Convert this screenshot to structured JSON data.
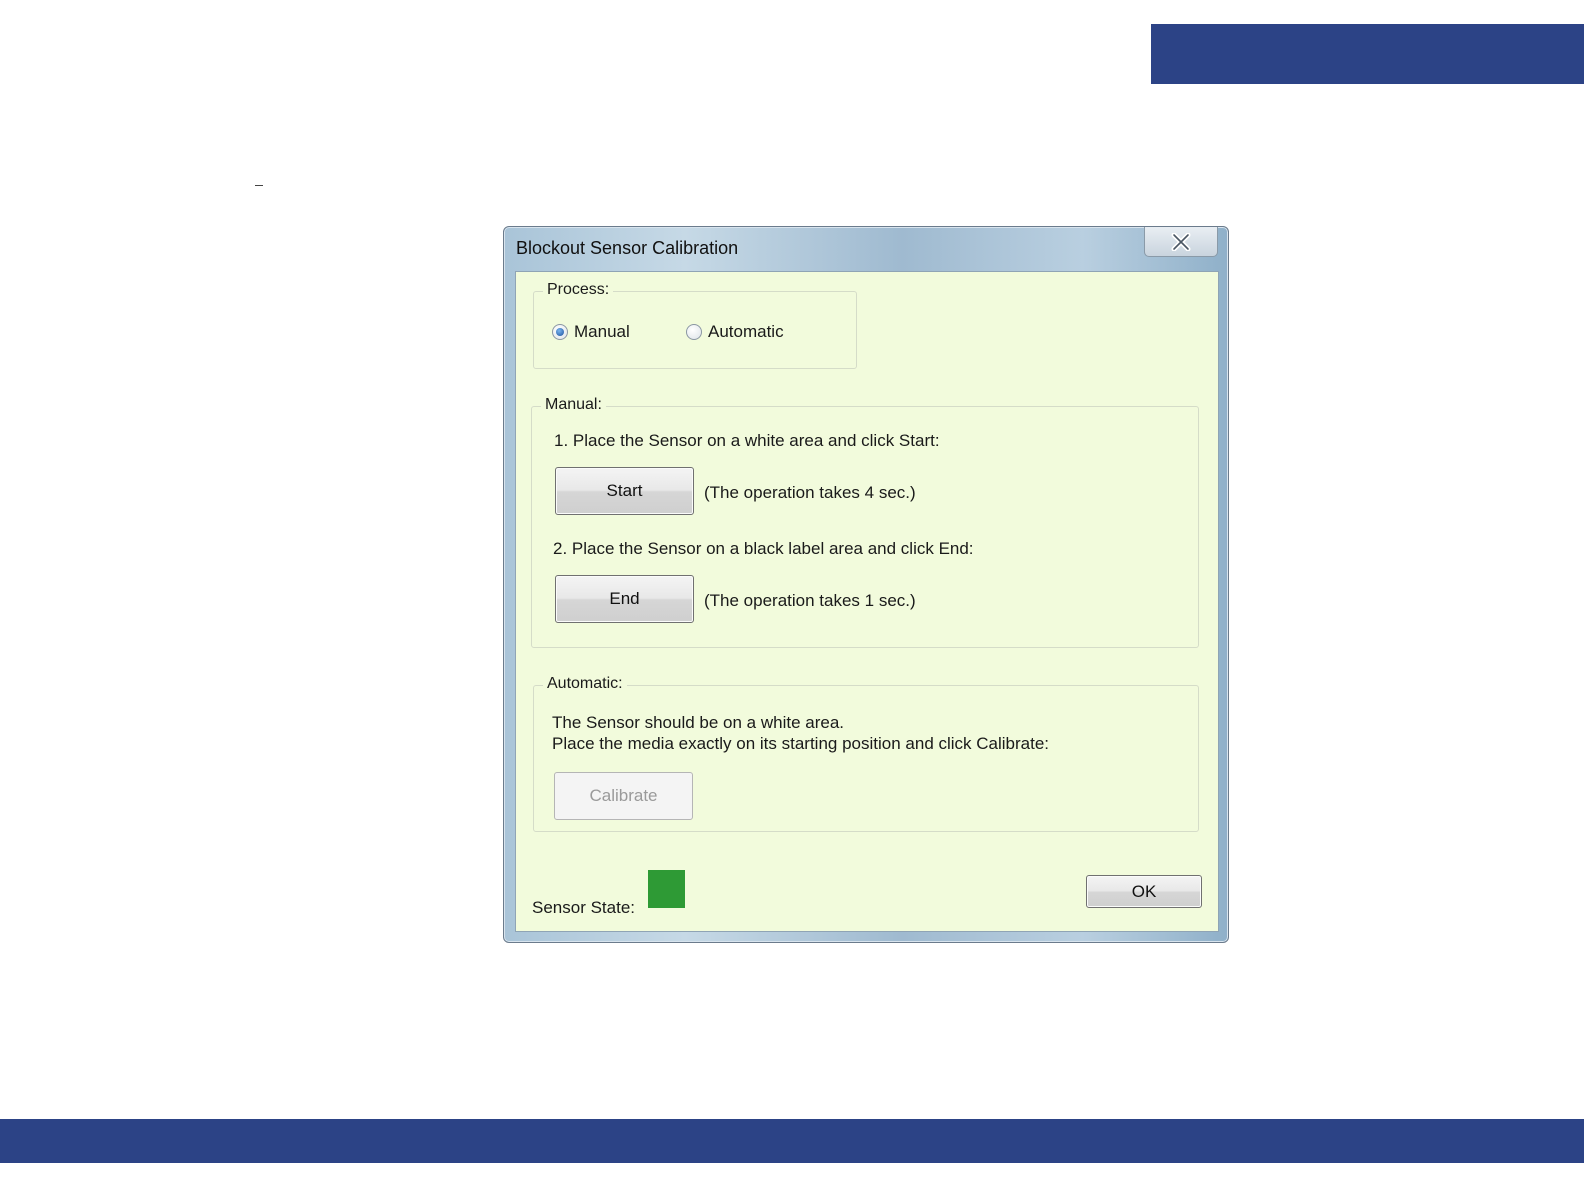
{
  "dialog": {
    "title": "Blockout Sensor Calibration",
    "close_icon": "close-icon"
  },
  "process": {
    "legend": "Process:",
    "options": [
      {
        "label": "Manual",
        "selected": true
      },
      {
        "label": "Automatic",
        "selected": false
      }
    ]
  },
  "manual": {
    "legend": "Manual:",
    "step1": "1. Place the Sensor on a white area and click Start:",
    "start_label": "Start",
    "start_note": "(The operation takes 4 sec.)",
    "step2": "2. Place the Sensor on a black label area and click End:",
    "end_label": "End",
    "end_note": "(The operation takes 1 sec.)"
  },
  "automatic": {
    "legend": "Automatic:",
    "line1": "The Sensor should be on a white area.",
    "line2": "Place the media exactly on its starting position and click Calibrate:",
    "calibrate_label": "Calibrate",
    "calibrate_enabled": false
  },
  "footer": {
    "sensor_label": "Sensor State:",
    "sensor_color": "#2e9a35",
    "ok_label": "OK"
  },
  "colors": {
    "banner": "#2c4386",
    "client_background": "#f2fbdc"
  }
}
